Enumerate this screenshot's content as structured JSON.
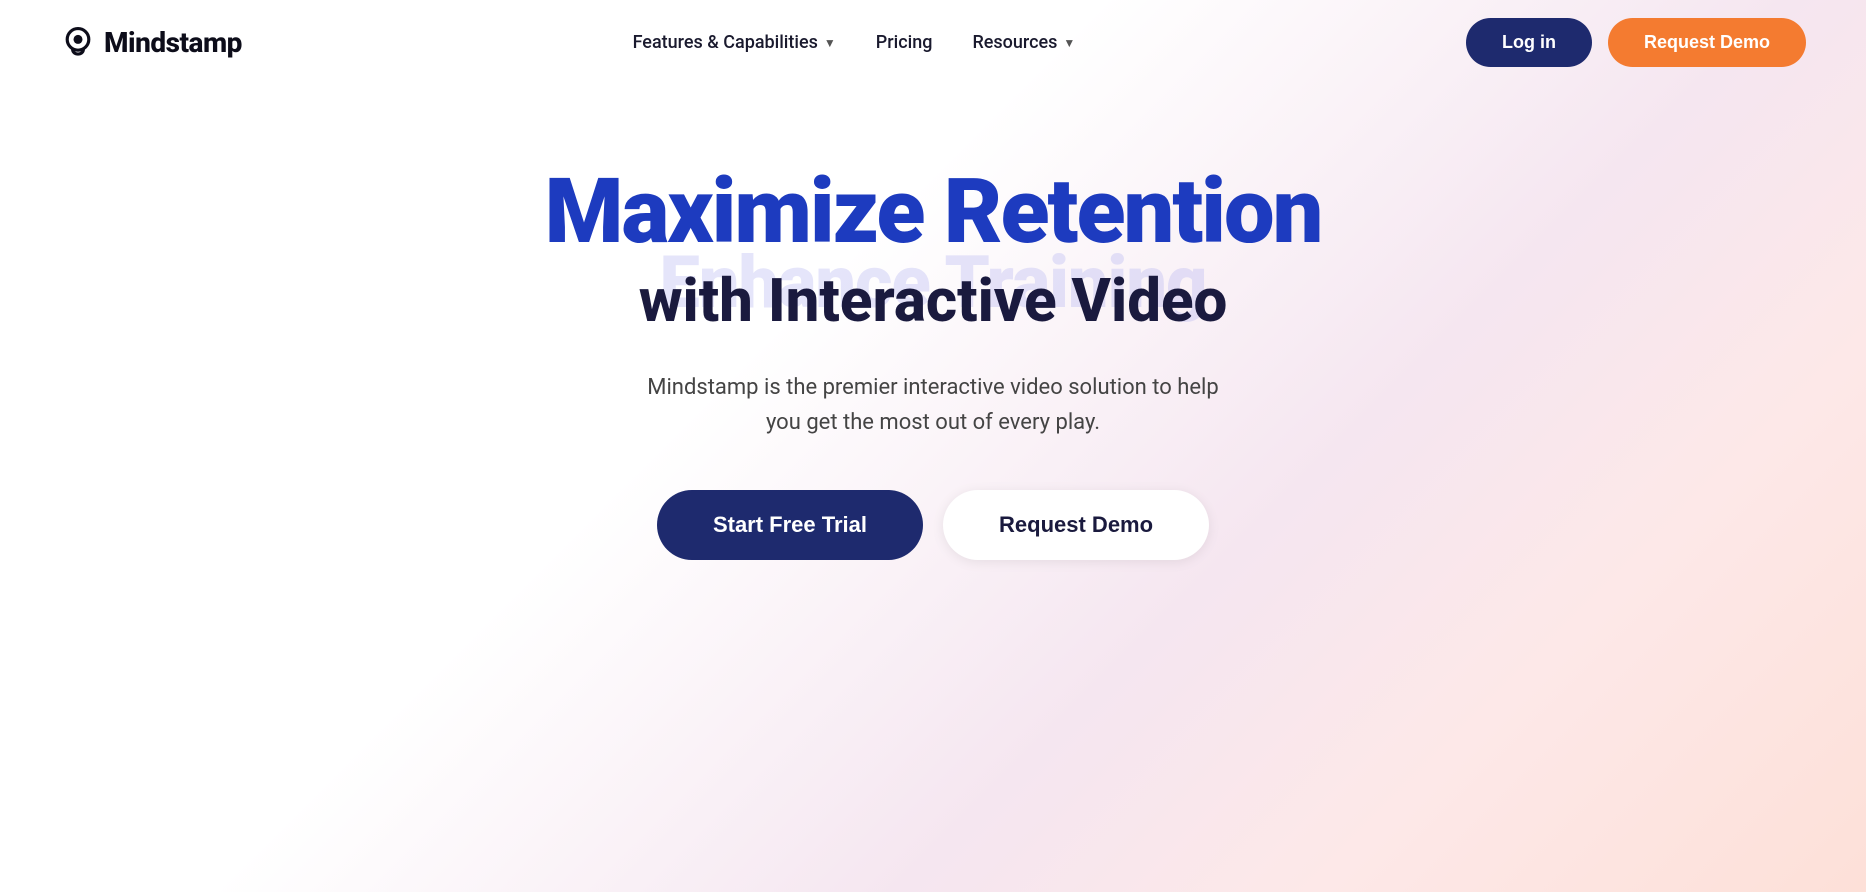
{
  "logo": {
    "text": "Mindstamp"
  },
  "nav": {
    "links": [
      {
        "label": "Features & Capabilities",
        "hasDropdown": true
      },
      {
        "label": "Pricing",
        "hasDropdown": false
      },
      {
        "label": "Resources",
        "hasDropdown": true
      }
    ],
    "login_label": "Log in",
    "request_demo_label": "Request Demo"
  },
  "hero": {
    "title_main": "Maximize Retention",
    "title_ghost": "Enhance Training",
    "subtitle": "with Interactive Video",
    "description": "Mindstamp is the premier interactive video solution to help you get the most out of every play.",
    "btn_trial": "Start Free Trial",
    "btn_demo": "Request Demo"
  },
  "colors": {
    "nav_bg": "#1e2a6e",
    "nav_demo_bg": "#f47b30",
    "hero_title": "#1d3bbf",
    "hero_subtitle": "#1a1a3e",
    "btn_trial_bg": "#1e2a6e",
    "btn_demo_bg": "#ffffff"
  }
}
